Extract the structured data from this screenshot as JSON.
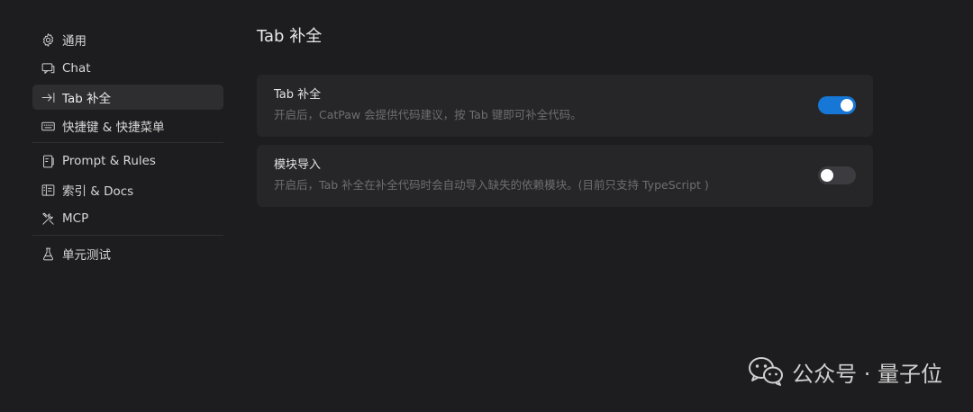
{
  "sidebar": {
    "items": [
      {
        "label": "通用",
        "icon": "gear-icon"
      },
      {
        "label": "Chat",
        "icon": "chat-icon"
      },
      {
        "label": "Tab 补全",
        "icon": "tab-arrow-icon",
        "active": true
      },
      {
        "label": "快捷键 & 快捷菜单",
        "icon": "keyboard-icon"
      },
      {
        "label": "Prompt & Rules",
        "icon": "document-icon"
      },
      {
        "label": "索引 & Docs",
        "icon": "book-icon"
      },
      {
        "label": "MCP",
        "icon": "tools-icon"
      },
      {
        "label": "单元测试",
        "icon": "flask-icon"
      }
    ]
  },
  "main": {
    "title": "Tab 补全",
    "settings": [
      {
        "title": "Tab 补全",
        "description": "开启后，CatPaw 会提供代码建议，按 Tab 键即可补全代码。",
        "enabled": true
      },
      {
        "title": "模块导入",
        "description": "开启后，Tab 补全在补全代码时会自动导入缺失的依赖模块。(目前只支持 TypeScript )",
        "enabled": false
      }
    ]
  },
  "watermark": {
    "text": "公众号 · 量子位",
    "icon": "wechat-icon"
  },
  "colors": {
    "accent": "#1677d6",
    "background": "#1d1d1f",
    "card": "#262628",
    "active_nav": "#2e2e31"
  }
}
